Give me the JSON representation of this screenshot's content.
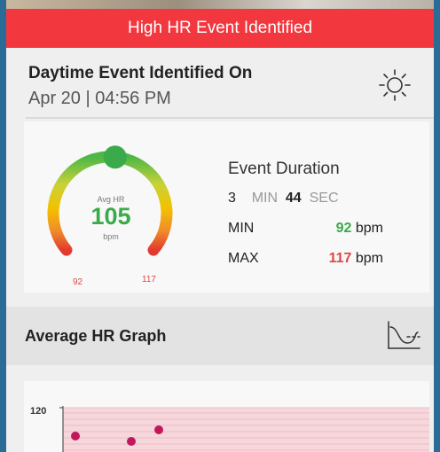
{
  "banner": {
    "title": "High HR Event Identified"
  },
  "event": {
    "title": "Daytime Event Identified On",
    "date": "Apr 20 | 04:56 PM",
    "period_icon": "sun-icon"
  },
  "gauge": {
    "label": "Avg HR",
    "value": "105",
    "unit": "bpm",
    "min": "92",
    "max": "117",
    "level": 0.52,
    "colors": {
      "low": "#3aaa4a",
      "mid": "#f2c200",
      "high": "#e23a2f"
    }
  },
  "duration": {
    "title": "Event Duration",
    "minutes": "3",
    "minutes_unit": "MIN",
    "seconds": "44",
    "seconds_unit": "SEC",
    "min_label": "MIN",
    "min_value": "92",
    "max_label": "MAX",
    "max_value": "117",
    "bpm_unit": "bpm"
  },
  "graph": {
    "title": "Average HR Graph",
    "icon": "curve-chart-icon",
    "y_tick": "120",
    "point_color": "#c2185b",
    "band_color": "#f6d7dc"
  },
  "colors": {
    "accent": "#f2373f",
    "green": "#3aaa4a",
    "red": "#e04545"
  }
}
